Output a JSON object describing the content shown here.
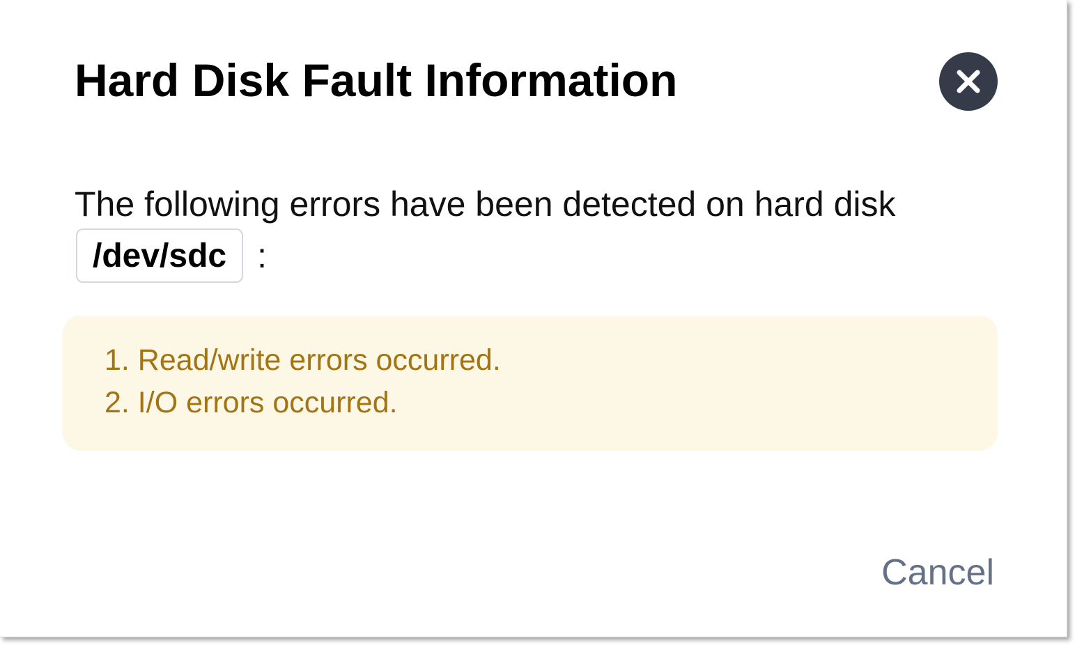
{
  "dialog": {
    "title": "Hard Disk Fault Information",
    "close_icon": "close-icon",
    "message": "The following errors have been detected on hard disk",
    "device": "/dev/sdc",
    "colon": ":",
    "errors": [
      {
        "text": "1. Read/write errors occurred."
      },
      {
        "text": "2. I/O errors occurred."
      }
    ],
    "cancel_label": "Cancel"
  },
  "colors": {
    "close_button_bg": "#353b48",
    "error_box_bg": "#fdf7e5",
    "error_text": "#a37414",
    "cancel_text": "#647187"
  }
}
